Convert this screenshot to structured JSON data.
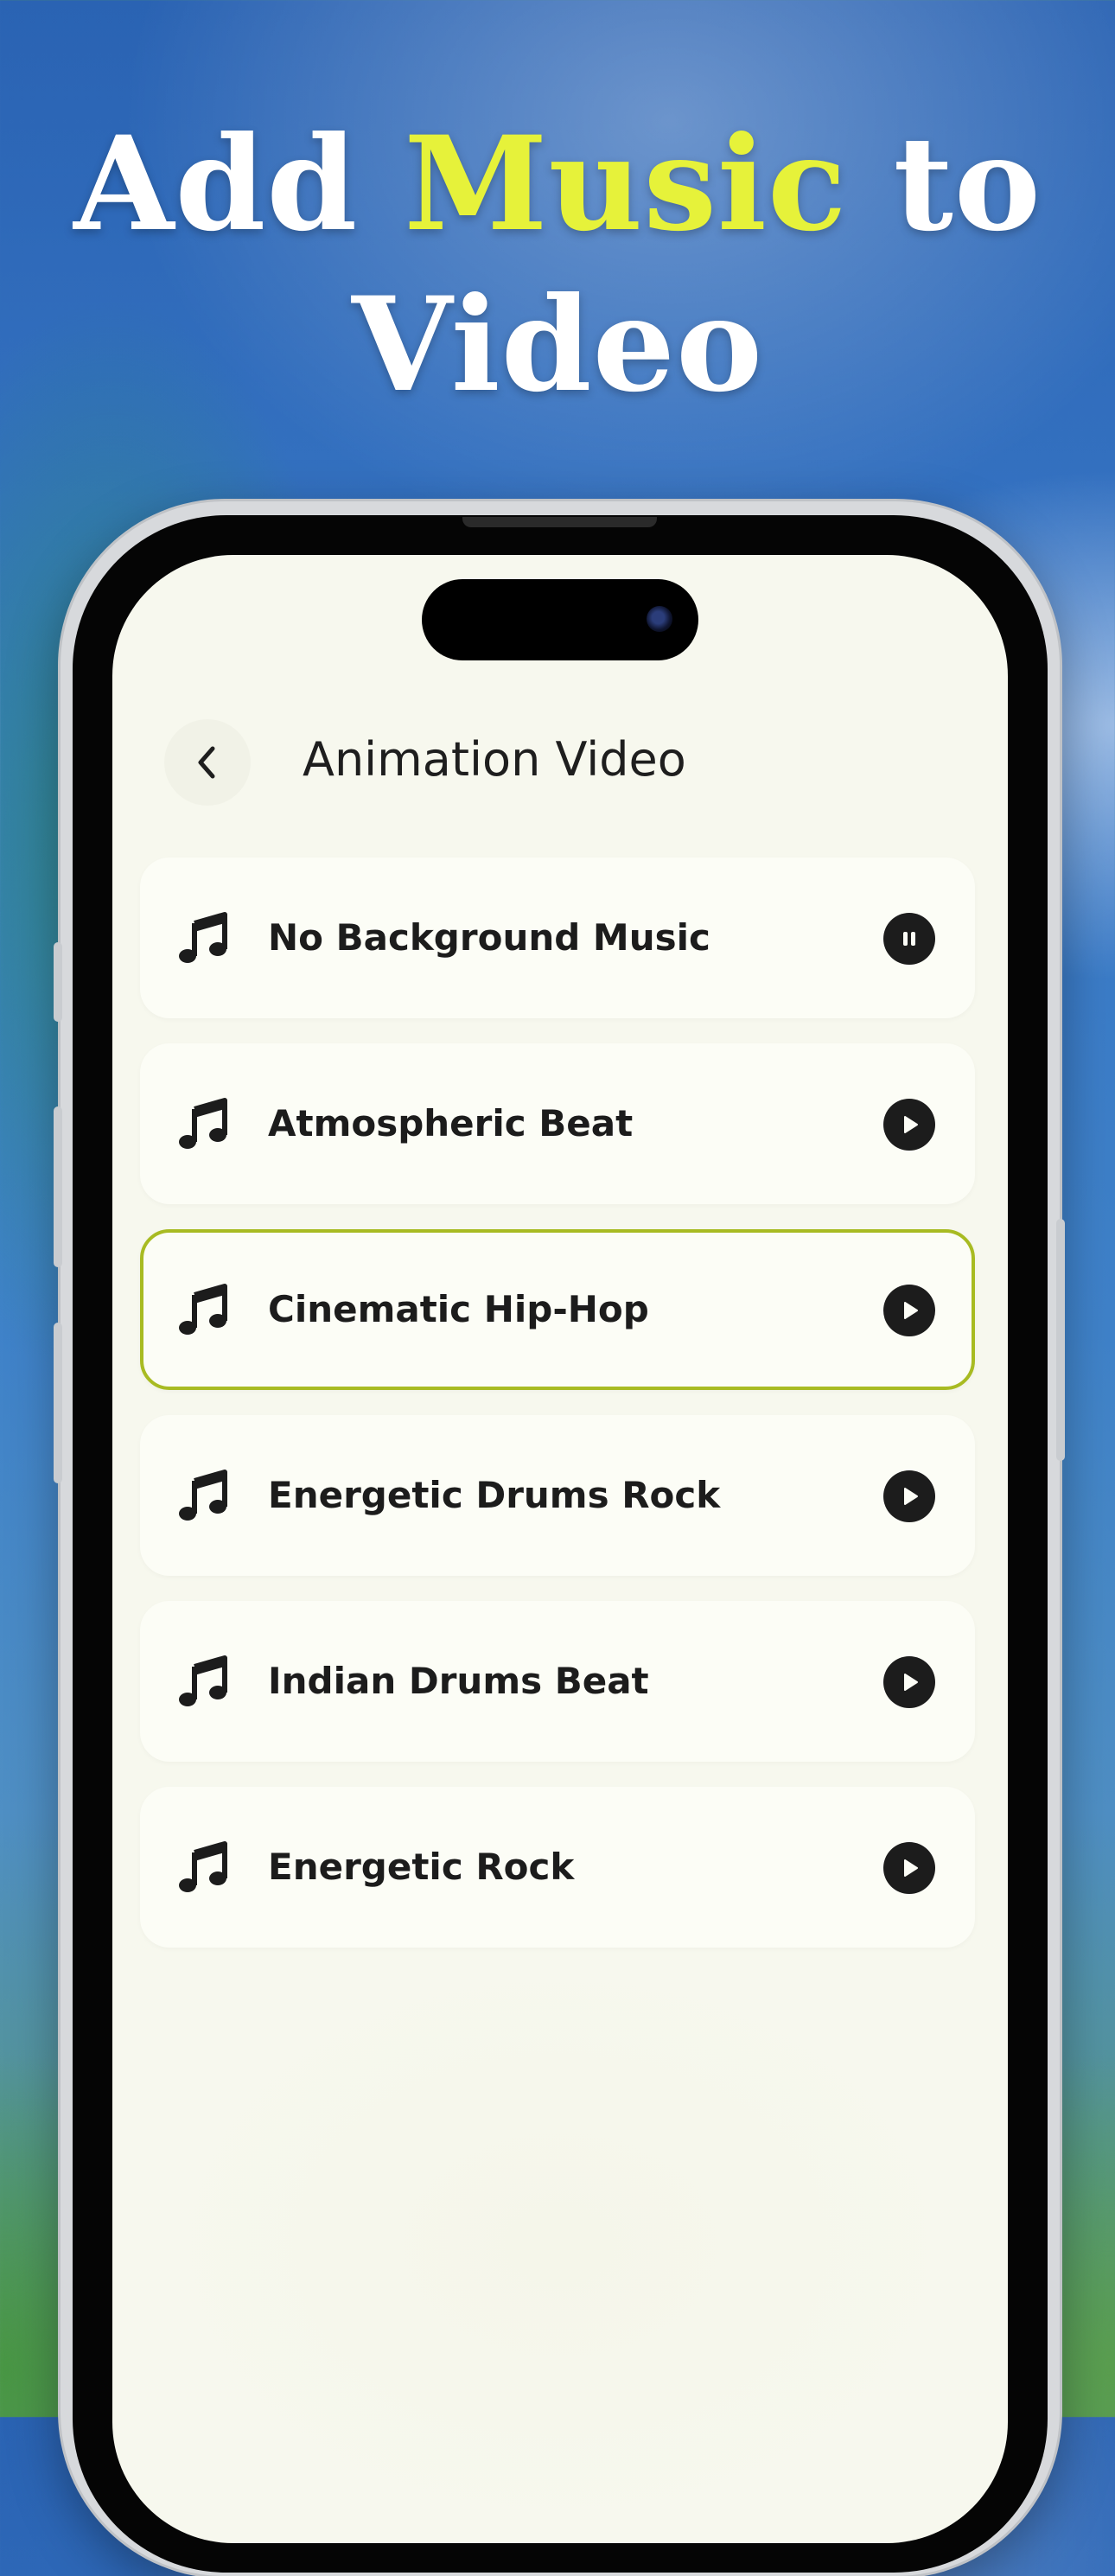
{
  "headline": {
    "part1": "Add ",
    "highlight": "Music",
    "part2": " to",
    "line2": "Video"
  },
  "colors": {
    "highlight": "#e6f23a",
    "selected_border": "#a8bb22",
    "screen_bg": "#f7f8ee"
  },
  "nav": {
    "back_icon": "chevron-left-icon",
    "title": "Animation Video"
  },
  "tracks": [
    {
      "label": "No Background Music",
      "icon": "music-note-icon",
      "state": "pause"
    },
    {
      "label": "Atmospheric Beat",
      "icon": "music-note-icon",
      "state": "play"
    },
    {
      "label": "Cinematic Hip-Hop",
      "icon": "music-note-icon",
      "state": "play",
      "selected": true
    },
    {
      "label": "Energetic Drums Rock",
      "icon": "music-note-icon",
      "state": "play"
    },
    {
      "label": "Indian Drums Beat",
      "icon": "music-note-icon",
      "state": "play"
    },
    {
      "label": "Energetic Rock",
      "icon": "music-note-icon",
      "state": "play"
    }
  ]
}
